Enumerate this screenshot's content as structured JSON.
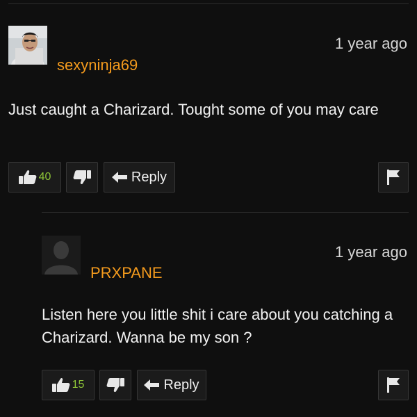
{
  "comments": [
    {
      "username": "sexyninja69",
      "time": "1 year ago",
      "text": "Just caught a Charizard. Tought some of you may care",
      "likes": "40",
      "reply_label": "Reply",
      "icons": {
        "like": "thumbs-up-icon",
        "dislike": "thumbs-down-icon",
        "reply": "reply-arrow-icon",
        "flag": "flag-icon"
      }
    },
    {
      "username": "PRXPANE",
      "time": "1 year ago",
      "text": "Listen here you little shit i care about you catching a Charizard. Wanna be my son ?",
      "likes": "15",
      "reply_label": "Reply",
      "icons": {
        "like": "thumbs-up-icon",
        "dislike": "thumbs-down-icon",
        "reply": "reply-arrow-icon",
        "flag": "flag-icon"
      }
    }
  ],
  "colors": {
    "background": "#0f0f0f",
    "username": "#f39a1d",
    "like_count": "#8ec537"
  }
}
